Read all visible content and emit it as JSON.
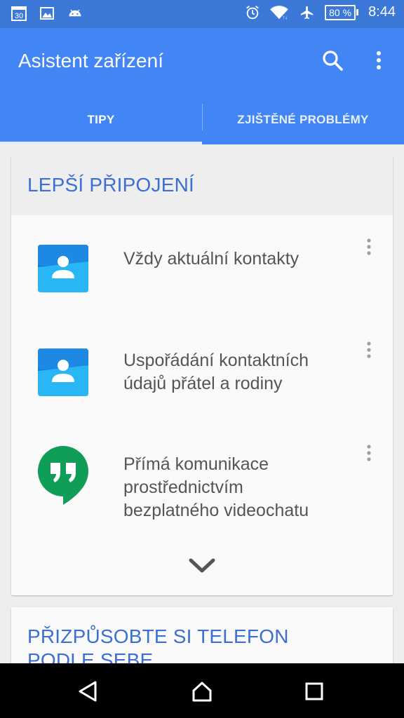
{
  "status_bar": {
    "left_icons": [
      "calendar-icon",
      "image-icon",
      "android-icon"
    ],
    "calendar_day": "30",
    "right_icons": [
      "alarm-icon",
      "wifi-icon",
      "airplane-icon"
    ],
    "battery": "80 %",
    "time": "8:44"
  },
  "app_bar": {
    "title": "Asistent zařízení",
    "actions": [
      "search-icon",
      "more-vert-icon"
    ]
  },
  "tabs": [
    {
      "label": "TIPY",
      "selected": true
    },
    {
      "label": "ZJIŠTĚNÉ PROBLÉMY",
      "selected": false
    }
  ],
  "cards": [
    {
      "title": "LEPŠÍ PŘIPOJENÍ",
      "items": [
        {
          "text_lines": [
            "Vždy aktuální kontakty"
          ],
          "icon": "contacts-icon"
        },
        {
          "text_lines": [
            "Uspořádání kontaktních",
            "údajů přátel a rodiny"
          ],
          "icon": "contacts-icon"
        },
        {
          "text_lines": [
            "Přímá komunikace",
            "prostřednictvím",
            "bezplatného videochatu"
          ],
          "icon": "hangouts-icon"
        }
      ],
      "expand_icon": "chevron-down-icon"
    },
    {
      "title_lines": [
        "PŘIZPŮSOBTE SI TELEFON",
        "PODLE SEBE"
      ]
    }
  ],
  "colors": {
    "status_bar": "#3b78d8",
    "app_bar": "#4285f4",
    "card_title": "#3b6fd4",
    "contacts_blue": "#1e88e5",
    "hangouts_green": "#0f9d58"
  },
  "nav_bar": [
    "back-icon",
    "home-icon",
    "recents-icon"
  ]
}
